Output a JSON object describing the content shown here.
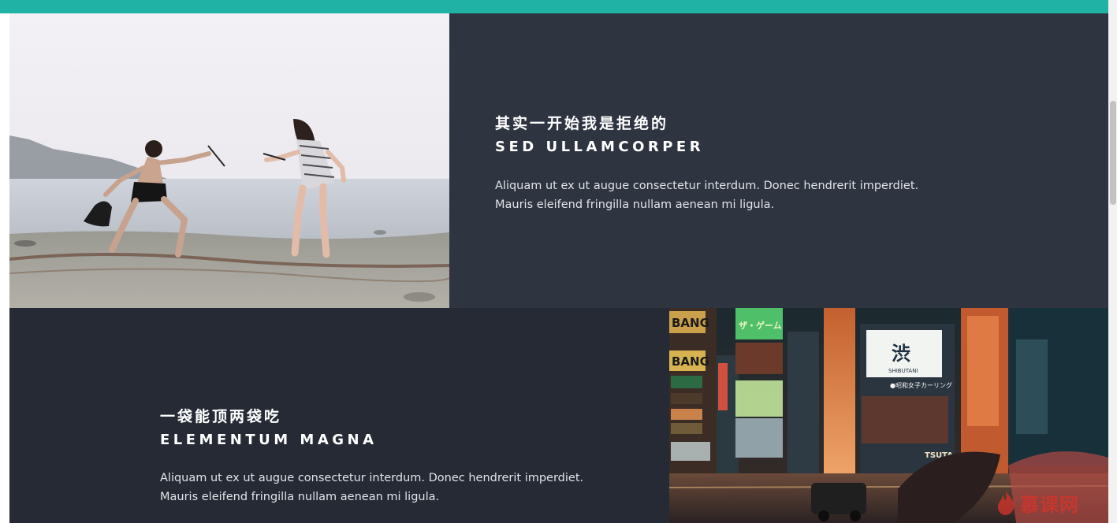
{
  "sections": [
    {
      "cn_title": "其实一开始我是拒绝的",
      "en_title": "SED ULLAMCORPER",
      "body_lines": [
        "Aliquam ut ex ut augue consectetur interdum. Donec hendrerit imperdiet.",
        "Mauris eleifend fringilla nullam aenean mi ligula."
      ],
      "image": "beach-fencing-photo"
    },
    {
      "cn_title": "一袋能顶两袋吃",
      "en_title": "ELEMENTUM MAGNA",
      "body_lines": [
        "Aliquam ut ex ut augue consectetur interdum. Donec hendrerit imperdiet.",
        "Mauris eleifend fringilla nullam aenean mi ligula."
      ],
      "image": "tokyo-night-street-photo"
    }
  ],
  "city_signs": {
    "sign_1": "BANG",
    "sign_2": "BANG",
    "sign_3": "ザ・ゲーム",
    "sign_4": "渋",
    "sign_5": "SHIBUTANI",
    "sign_6": "●昭和女子カーリング",
    "sign_7": "TSUTA"
  },
  "watermark": {
    "text": "慕课网",
    "icon": "flame-icon"
  },
  "colors": {
    "accent": "#21b2a6",
    "section_dark": "#2e3440",
    "section_darker": "#252a35"
  }
}
